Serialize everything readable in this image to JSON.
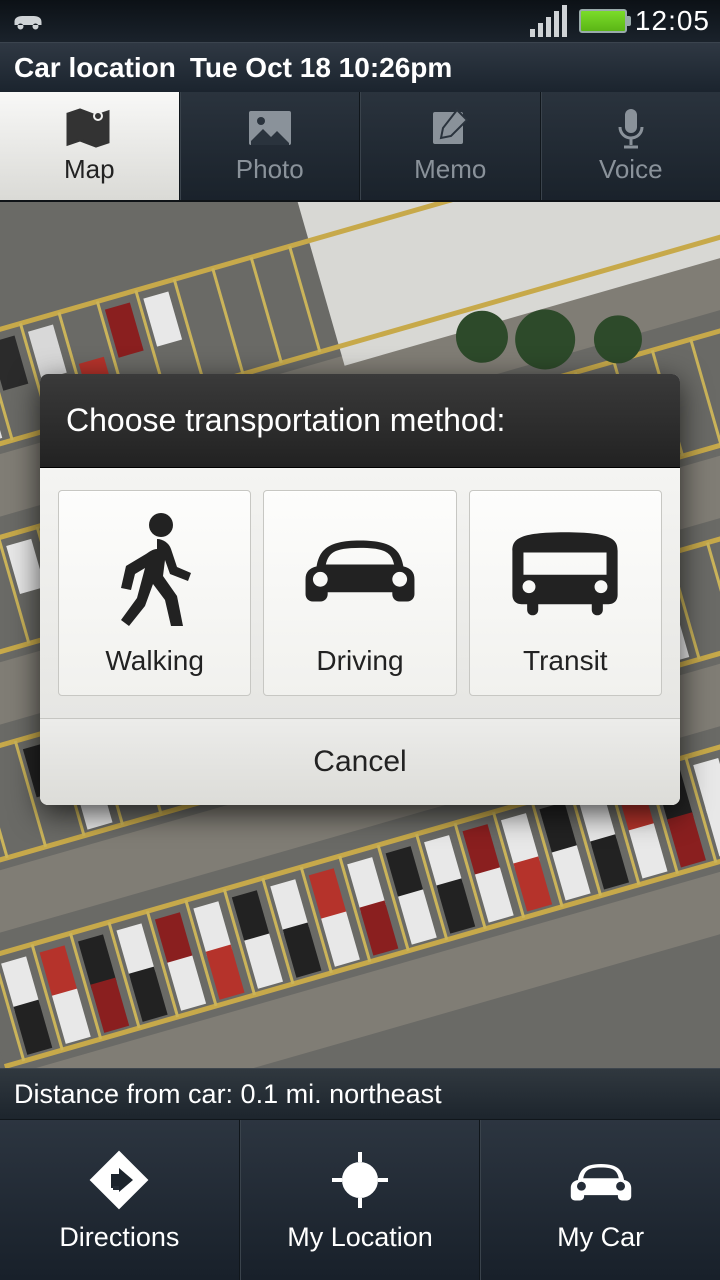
{
  "status": {
    "time": "12:05"
  },
  "title": {
    "label": "Car location",
    "datetime": "Tue Oct 18  10:26pm"
  },
  "tabs": [
    {
      "label": "Map",
      "icon": "map-icon",
      "active": true
    },
    {
      "label": "Photo",
      "icon": "photo-icon",
      "active": false
    },
    {
      "label": "Memo",
      "icon": "memo-icon",
      "active": false
    },
    {
      "label": "Voice",
      "icon": "voice-icon",
      "active": false
    }
  ],
  "dialog": {
    "title": "Choose transportation method:",
    "options": [
      {
        "label": "Walking",
        "icon": "walking-icon"
      },
      {
        "label": "Driving",
        "icon": "driving-icon"
      },
      {
        "label": "Transit",
        "icon": "transit-icon"
      }
    ],
    "cancel": "Cancel"
  },
  "distance_text": "Distance from car: 0.1 mi. northeast",
  "bottom": [
    {
      "label": "Directions",
      "icon": "directions-icon"
    },
    {
      "label": "My Location",
      "icon": "locate-icon"
    },
    {
      "label": "My Car",
      "icon": "car-icon"
    }
  ]
}
